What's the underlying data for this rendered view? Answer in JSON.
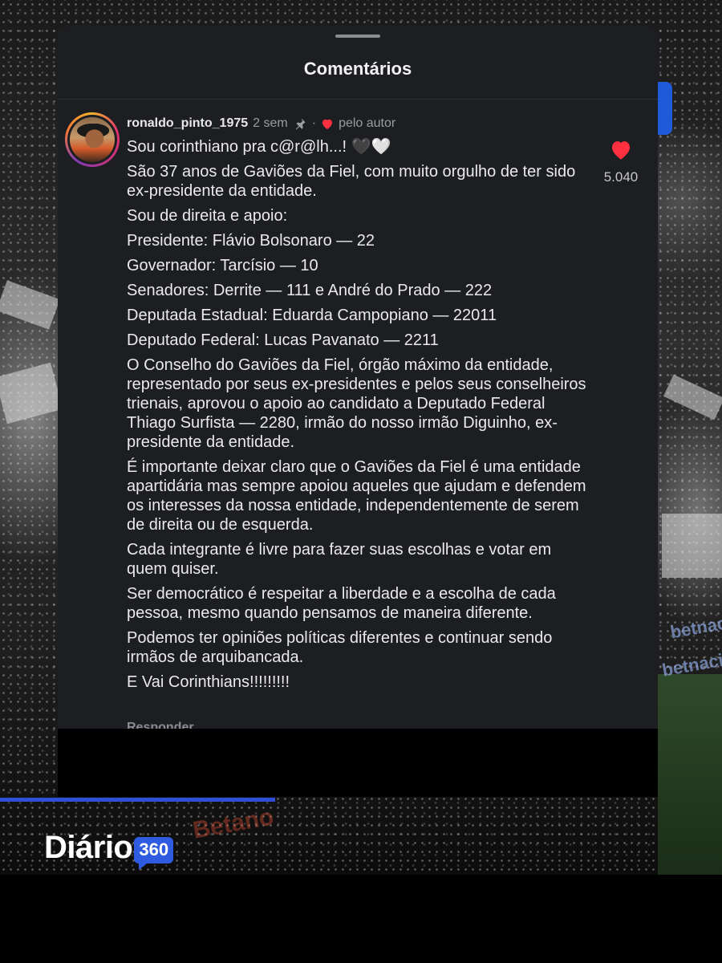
{
  "sheet": {
    "title": "Comentários",
    "reply_label": "Responder"
  },
  "comment": {
    "username": "ronaldo_pinto_1975",
    "time": "2 sem",
    "separator": "·",
    "liked_by_author": "pelo autor",
    "like_count": "5.040",
    "paragraphs": [
      "Sou corinthiano pra c@r@lh...! 🖤🤍",
      "São 37 anos de Gaviões da Fiel, com muito orgulho de ter sido ex-presidente da entidade.",
      "Sou de direita e apoio:",
      "Presidente: Flávio Bolsonaro — 22",
      "Governador: Tarcísio — 10",
      "Senadores: Derrite — 111 e André do Prado — 222",
      "Deputada Estadual: Eduarda Campopiano — 22011",
      "Deputado Federal: Lucas Pavanato — 2211",
      "O Conselho do Gaviões da Fiel, órgão máximo da entidade, representado por seus ex-presidentes e pelos seus conselheiros trienais, aprovou o apoio ao candidato a Deputado Federal Thiago Surfista — 2280, irmão do nosso irmão Diguinho, ex-presidente da entidade.",
      "É importante deixar claro que o Gaviões da Fiel é uma entidade apartidária mas sempre apoiou aqueles que ajudam e defendem os interesses da nossa entidade, independentemente de serem de direita ou de esquerda.",
      "Cada integrante é livre para fazer suas escolhas e votar em quem quiser.",
      "Ser democrático é respeitar a liberdade e a escolha de cada pessoa, mesmo quando pensamos de maneira diferente.",
      "Podemos ter opiniões políticas diferentes e continuar sendo irmãos de arquibancada.",
      "E Vai Corinthians!!!!!!!!!"
    ]
  },
  "watermark": {
    "brand": "Diário",
    "badge": "360"
  },
  "background": {
    "sponsor_1": "betnacional",
    "sponsor_2": "betnacio",
    "sponsor_3": "Betano"
  },
  "colors": {
    "sheet_bg": "#1c1e22",
    "heart": "#ff3040",
    "brand_blue": "#2f5be0"
  }
}
